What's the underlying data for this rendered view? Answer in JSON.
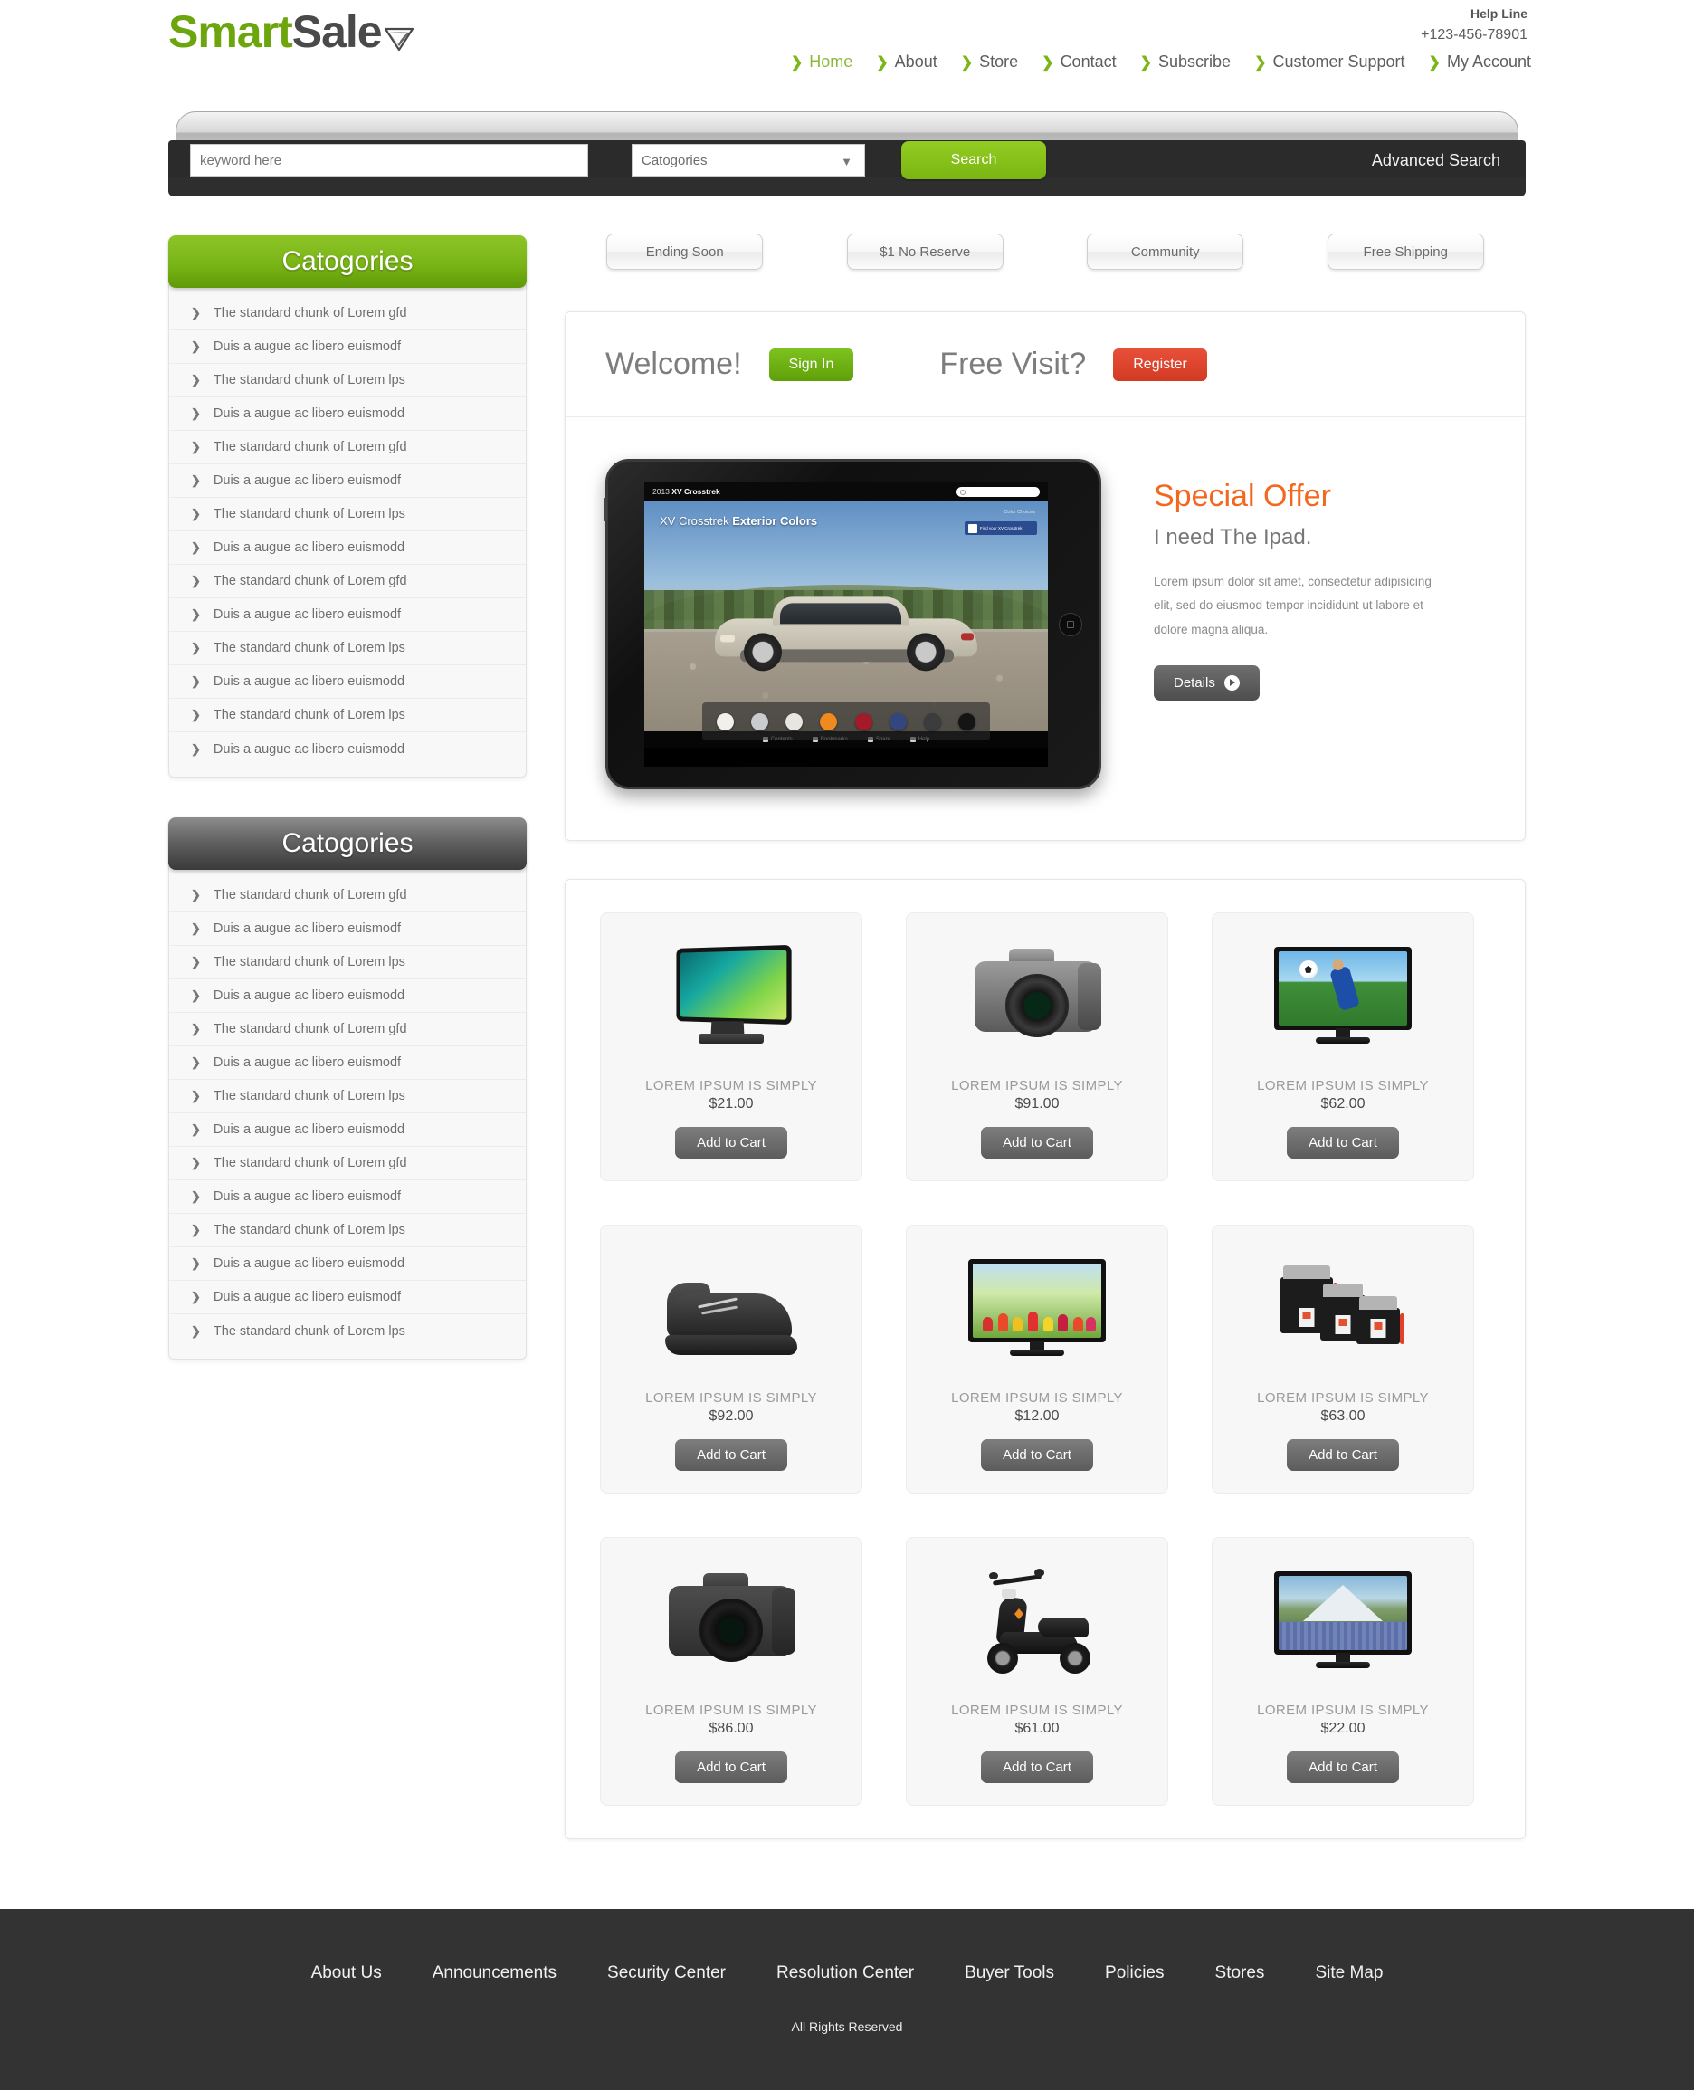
{
  "brand": {
    "name_part1": "Smart",
    "name_part2": "Sale",
    "logo_icon": "shield-badge-icon"
  },
  "header": {
    "help_label": "Help Line",
    "help_phone": "+123-456-78901",
    "nav": [
      {
        "label": "Home",
        "active": true
      },
      {
        "label": "About",
        "active": false
      },
      {
        "label": "Store",
        "active": false
      },
      {
        "label": "Contact",
        "active": false
      },
      {
        "label": "Subscribe",
        "active": false
      },
      {
        "label": "Customer Support",
        "active": false
      },
      {
        "label": "My Account",
        "active": false
      }
    ]
  },
  "search": {
    "keyword_placeholder": "keyword here",
    "keyword_value": "",
    "category_selected": "Catogories",
    "category_options": [
      "Catogories"
    ],
    "button_label": "Search",
    "advanced_label": "Advanced Search"
  },
  "filters": [
    {
      "label": "Ending Soon"
    },
    {
      "label": "$1 No Reserve"
    },
    {
      "label": "Community"
    },
    {
      "label": "Free Shipping"
    }
  ],
  "sidebar": {
    "panels": [
      {
        "title": "Catogories",
        "style": "green",
        "items": [
          {
            "label": "The standard chunk of Lorem gfd"
          },
          {
            "label": "Duis a augue ac libero euismodf"
          },
          {
            "label": "The standard chunk of Lorem lps"
          },
          {
            "label": "Duis a augue ac libero euismodd"
          },
          {
            "label": "The standard chunk of Lorem gfd"
          },
          {
            "label": "Duis a augue ac libero euismodf"
          },
          {
            "label": "The standard chunk of Lorem lps"
          },
          {
            "label": "Duis a augue ac libero euismodd"
          },
          {
            "label": "The standard chunk of Lorem gfd"
          },
          {
            "label": "Duis a augue ac libero euismodf"
          },
          {
            "label": "The standard chunk of Lorem lps"
          },
          {
            "label": "Duis a augue ac libero euismodd"
          },
          {
            "label": "The standard chunk of Lorem lps"
          },
          {
            "label": "Duis a augue ac libero euismodd"
          }
        ]
      },
      {
        "title": "Catogories",
        "style": "grey",
        "items": [
          {
            "label": "The standard chunk of Lorem gfd"
          },
          {
            "label": "Duis a augue ac libero euismodf"
          },
          {
            "label": "The standard chunk of Lorem lps"
          },
          {
            "label": "Duis a augue ac libero euismodd"
          },
          {
            "label": "The standard chunk of Lorem gfd"
          },
          {
            "label": "Duis a augue ac libero euismodf"
          },
          {
            "label": "The standard chunk of Lorem lps"
          },
          {
            "label": "Duis a augue ac libero euismodd"
          },
          {
            "label": "The standard chunk of Lorem gfd"
          },
          {
            "label": "Duis a augue ac libero euismodf"
          },
          {
            "label": "The standard chunk of Lorem lps"
          },
          {
            "label": "Duis a augue ac libero euismodd"
          },
          {
            "label": "Duis a augue ac libero euismodf"
          },
          {
            "label": "The standard chunk of Lorem lps"
          }
        ]
      }
    ]
  },
  "welcome": {
    "welcome_text": "Welcome!",
    "signin_label": "Sign In",
    "free_visit_text": "Free Visit?",
    "register_label": "Register"
  },
  "hero": {
    "title": "Special Offer",
    "subtitle": "I need The Ipad.",
    "body": "Lorem ipsum dolor sit amet, consectetur adipisicing elit, sed do eiusmod tempor incididunt ut labore et dolore magna aliqua.",
    "details_label": "Details",
    "accent_color": "#f4671f",
    "tablet_screen": {
      "topbar_year": "2013",
      "topbar_model": "XV Crosstrek",
      "headline_model": "XV Crosstrek",
      "headline_bold": "Exterior Colors",
      "color_choices_label": "Color Choices",
      "cta_label": "Find your XV Crosstrek",
      "swatches": [
        "#f2f0ea",
        "#c9ccce",
        "#e8e6e0",
        "#f08a1e",
        "#a31b28",
        "#33477e",
        "#3a3c3e",
        "#141414"
      ],
      "bottom_nav": [
        "Contents",
        "Bookmarks",
        "Share",
        "Help"
      ]
    }
  },
  "products": {
    "add_to_cart_label": "Add to Cart",
    "items": [
      {
        "name": "LOREM IPSUM IS SIMPLY",
        "price": "$21.00",
        "art": "monitor-aio"
      },
      {
        "name": "LOREM IPSUM IS SIMPLY",
        "price": "$91.00",
        "art": "camera-silver"
      },
      {
        "name": "LOREM IPSUM IS SIMPLY",
        "price": "$62.00",
        "art": "tv-soccer"
      },
      {
        "name": "LOREM IPSUM IS SIMPLY",
        "price": "$92.00",
        "art": "shoe"
      },
      {
        "name": "LOREM IPSUM IS SIMPLY",
        "price": "$12.00",
        "art": "tv-tulips"
      },
      {
        "name": "LOREM IPSUM IS SIMPLY",
        "price": "$63.00",
        "art": "pouches"
      },
      {
        "name": "LOREM IPSUM IS SIMPLY",
        "price": "$86.00",
        "art": "camera-black"
      },
      {
        "name": "LOREM IPSUM IS SIMPLY",
        "price": "$61.00",
        "art": "scooter"
      },
      {
        "name": "LOREM IPSUM IS SIMPLY",
        "price": "$22.00",
        "art": "tv-mountain"
      }
    ]
  },
  "footer": {
    "links": [
      {
        "label": "About Us"
      },
      {
        "label": "Announcements"
      },
      {
        "label": "Security Center"
      },
      {
        "label": "Resolution Center"
      },
      {
        "label": "Buyer Tools"
      },
      {
        "label": "Policies"
      },
      {
        "label": "Stores"
      },
      {
        "label": "Site Map"
      }
    ],
    "copyright": "All Rights Reserved"
  }
}
